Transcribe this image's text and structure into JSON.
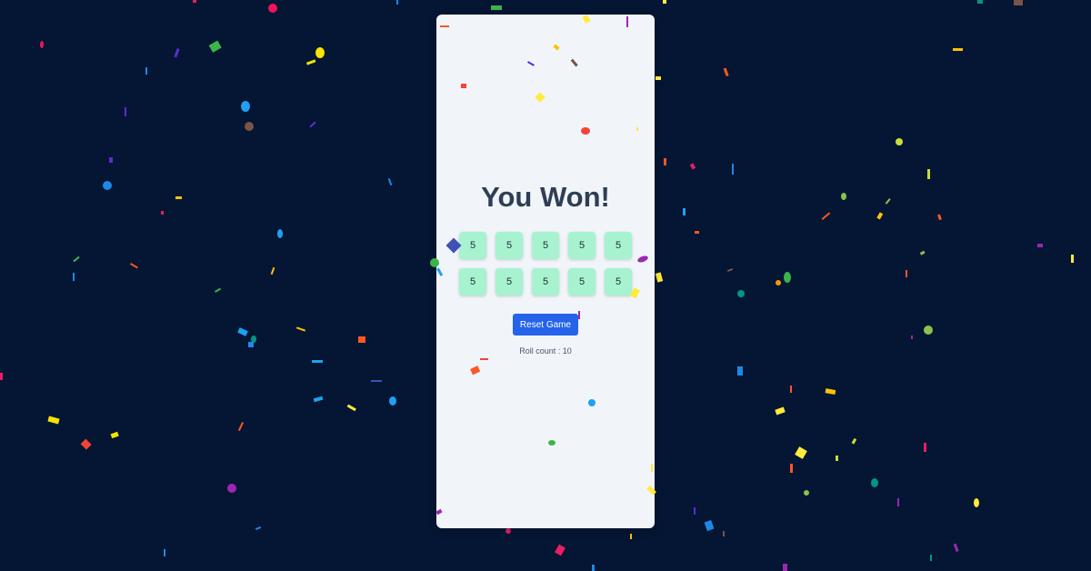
{
  "game": {
    "title": "You Won!",
    "dice": [
      {
        "value": "5"
      },
      {
        "value": "5"
      },
      {
        "value": "5"
      },
      {
        "value": "5"
      },
      {
        "value": "5"
      },
      {
        "value": "5"
      },
      {
        "value": "5"
      },
      {
        "value": "5"
      },
      {
        "value": "5"
      },
      {
        "value": "5"
      }
    ],
    "reset_label": "Reset Game",
    "roll_count_text": "Roll count : 10"
  },
  "colors": {
    "background": "#041634",
    "card": "#f1f5f9",
    "title": "#2f3e55",
    "die": "#a7f3d0",
    "button": "#2563eb"
  }
}
